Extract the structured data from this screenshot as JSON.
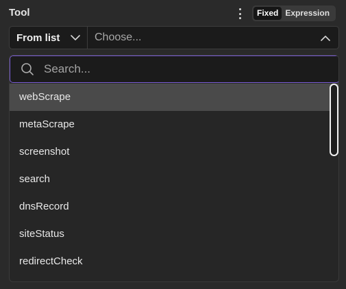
{
  "field": {
    "label": "Tool",
    "more_icon": "vertical-ellipsis-icon"
  },
  "mode_toggle": {
    "options": [
      "Fixed",
      "Expression"
    ],
    "active": "Fixed"
  },
  "selector": {
    "mode_value": "From list",
    "mode_icon": "chevron-down-icon",
    "value_placeholder": "Choose...",
    "value_icon": "chevron-up-icon"
  },
  "search": {
    "placeholder": "Search...",
    "icon": "search-icon"
  },
  "items": [
    {
      "label": "webScrape",
      "highlighted": true
    },
    {
      "label": "metaScrape",
      "highlighted": false
    },
    {
      "label": "screenshot",
      "highlighted": false
    },
    {
      "label": "search",
      "highlighted": false
    },
    {
      "label": "dnsRecord",
      "highlighted": false
    },
    {
      "label": "siteStatus",
      "highlighted": false
    },
    {
      "label": "redirectCheck",
      "highlighted": false
    }
  ],
  "colors": {
    "accent": "#7b5ed6",
    "background": "#2a2a2a",
    "highlight": "#4a4a4a"
  }
}
